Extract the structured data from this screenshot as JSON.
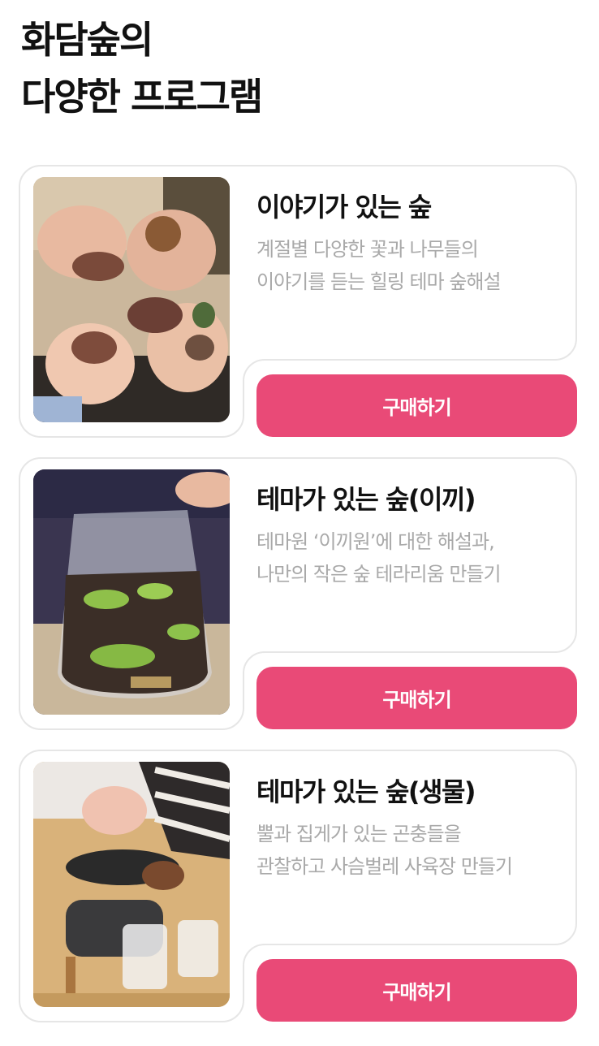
{
  "header": {
    "title_line1": "화담숲의",
    "title_line2": "다양한 프로그램"
  },
  "programs": [
    {
      "title": "이야기가 있는 숲",
      "desc_line1": "계절별 다양한 꽃과 나무들의",
      "desc_line2": "이야기를 듣는 힐링 테마 숲해설",
      "button_label": "구매하기"
    },
    {
      "title": "테마가 있는 숲(이끼)",
      "desc_line1": "테마원 ‘이끼원’에 대한 해설과,",
      "desc_line2": "나만의 작은 숲 테라리움 만들기",
      "button_label": "구매하기"
    },
    {
      "title": "테마가 있는 숲(생물)",
      "desc_line1": "뿔과 집게가 있는 곤충들을",
      "desc_line2": "관찰하고 사슴벌레 사육장 만들기",
      "button_label": "구매하기"
    }
  ],
  "colors": {
    "accent": "#e94a77",
    "title_text": "#111111",
    "desc_text": "#a9a9a9",
    "card_border": "#e6e6e6"
  }
}
